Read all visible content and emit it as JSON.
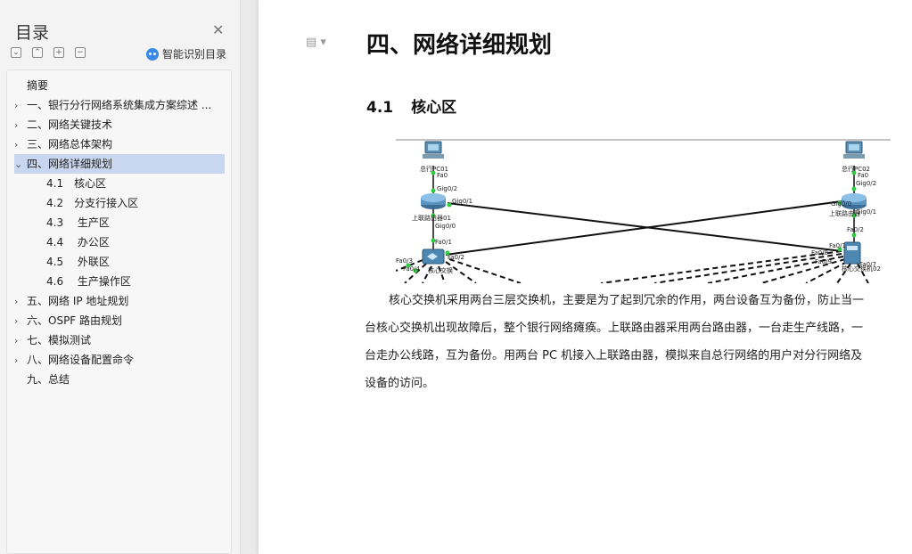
{
  "sidebar": {
    "title": "目录",
    "smart_toc_label": "智能识别目录",
    "items": [
      {
        "label": "摘要",
        "arrow": ""
      },
      {
        "label": "一、银行分行网络系统集成方案综述 ...",
        "arrow": "›"
      },
      {
        "label": "二、网络关键技术",
        "arrow": "›"
      },
      {
        "label": "三、网络总体架构",
        "arrow": "›"
      },
      {
        "label": "四、网络详细规划",
        "arrow": "⌄"
      },
      {
        "label": "4.1　核心区",
        "arrow": ""
      },
      {
        "label": "4.2　分支行接入区",
        "arrow": ""
      },
      {
        "label": "4.3　 生产区",
        "arrow": ""
      },
      {
        "label": "4.4　 办公区",
        "arrow": ""
      },
      {
        "label": "4.5　 外联区",
        "arrow": ""
      },
      {
        "label": "4.6　 生产操作区",
        "arrow": ""
      },
      {
        "label": "五、网络 IP 地址规划",
        "arrow": "›"
      },
      {
        "label": "六、OSPF 路由规划",
        "arrow": "›"
      },
      {
        "label": "七、模拟测试",
        "arrow": "›"
      },
      {
        "label": "八、网络设备配置命令",
        "arrow": "›"
      },
      {
        "label": "九、总结",
        "arrow": ""
      }
    ]
  },
  "document": {
    "heading1": "四、网络详细规划",
    "heading2_num": "4.1",
    "heading2_text": "核心区",
    "paragraph": "核心交换机采用两台三层交换机，主要是为了起到冗余的作用，两台设备互为备份，防止当一台核心交换机出现故障后，整个银行网络瘫痪。上联路由器采用两台路由器，一台走生产线路，一台走办公线路，互为备份。用两台 PC 机接入上联路由器，模拟来自总行网络的用户对分行网络及设备的访问。"
  },
  "diagram": {
    "pc_left_label": "总行PC01",
    "pc_right_label": "总行PC02",
    "router_left_label": "上联路由器01",
    "router_right_label": "上联路由器",
    "switch_left_label": "核心交换",
    "switch_right_label": "核心交换机02",
    "ports": {
      "l_pc_fa0": "Fa0",
      "l_r_g02": "Gig0/2",
      "l_r_g01": "Gig0/1",
      "l_r_g00": "Gig0/0",
      "l_sw_fa01": "Fa0/1",
      "l_sw_fa02": "Fa0/2",
      "l_sw_fa03": "Fa0/3",
      "l_sw_fa04": "Fa0/4",
      "r_pc_fa0": "Fa0",
      "r_r_g02": "Gig0/2",
      "r_r_g00": "Gig0/0",
      "r_r_g01": "Gig0/1",
      "r_sw_fa02": "Fa0/2",
      "r_sw_fa01": "Fa0/1",
      "r_sw_fa08": "Fa0/8",
      "r_sw_fa09": "Fa0/9",
      "r_sw_fa07": "Fa0/7"
    }
  }
}
